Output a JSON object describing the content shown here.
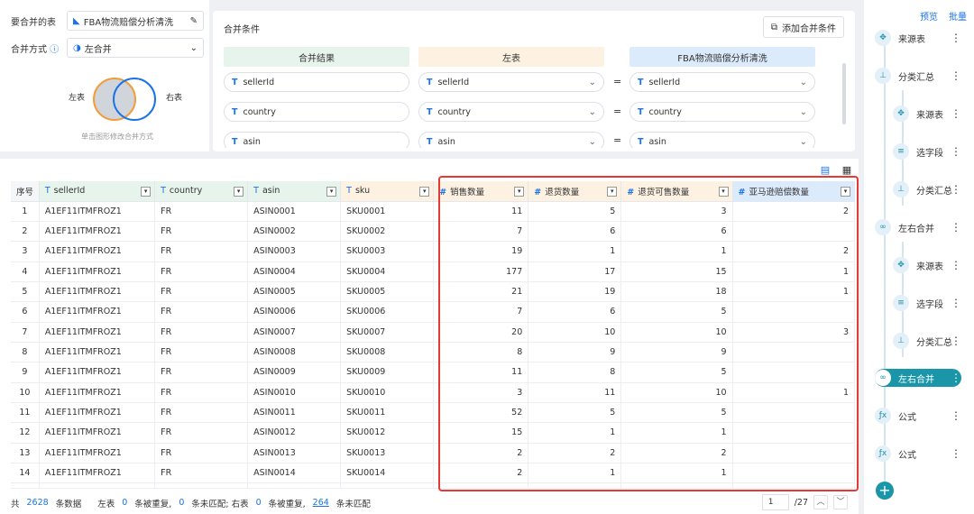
{
  "config": {
    "table_label": "要合并的表",
    "table_name": "FBA物流赔偿分析清洗",
    "method_label": "合并方式",
    "method_value": "左合并",
    "left_label": "左表",
    "right_label": "右表",
    "hint": "单击图形修改合并方式"
  },
  "conditions": {
    "title": "合并条件",
    "add_button": "添加合并条件",
    "headers": {
      "result": "合并结果",
      "left": "左表",
      "right": "FBA物流赔偿分析清洗"
    },
    "rows": [
      {
        "result": "sellerId",
        "left": "sellerId",
        "right": "sellerId"
      },
      {
        "result": "country",
        "left": "country",
        "right": "country"
      },
      {
        "result": "asin",
        "left": "asin",
        "right": "asin"
      }
    ]
  },
  "grid": {
    "columns": [
      {
        "label": "序号",
        "type": "",
        "color": "plain"
      },
      {
        "label": "sellerId",
        "type": "T",
        "color": "g"
      },
      {
        "label": "country",
        "type": "T",
        "color": "g"
      },
      {
        "label": "asin",
        "type": "T",
        "color": "g"
      },
      {
        "label": "sku",
        "type": "T",
        "color": "o"
      },
      {
        "label": "销售数量",
        "type": "#",
        "color": "o"
      },
      {
        "label": "退货数量",
        "type": "#",
        "color": "o"
      },
      {
        "label": "退货可售数量",
        "type": "#",
        "color": "o"
      },
      {
        "label": "亚马逊赔偿数量",
        "type": "#",
        "color": "b"
      }
    ],
    "rows": [
      [
        "1",
        "A1EF11ITMFROZ1",
        "FR",
        "ASIN0001",
        "SKU0001",
        "11",
        "5",
        "3",
        "2"
      ],
      [
        "2",
        "A1EF11ITMFROZ1",
        "FR",
        "ASIN0002",
        "SKU0002",
        "7",
        "6",
        "6",
        ""
      ],
      [
        "3",
        "A1EF11ITMFROZ1",
        "FR",
        "ASIN0003",
        "SKU0003",
        "19",
        "1",
        "1",
        "2"
      ],
      [
        "4",
        "A1EF11ITMFROZ1",
        "FR",
        "ASIN0004",
        "SKU0004",
        "177",
        "17",
        "15",
        "1"
      ],
      [
        "5",
        "A1EF11ITMFROZ1",
        "FR",
        "ASIN0005",
        "SKU0005",
        "21",
        "19",
        "18",
        "1"
      ],
      [
        "6",
        "A1EF11ITMFROZ1",
        "FR",
        "ASIN0006",
        "SKU0006",
        "7",
        "6",
        "5",
        ""
      ],
      [
        "7",
        "A1EF11ITMFROZ1",
        "FR",
        "ASIN0007",
        "SKU0007",
        "20",
        "10",
        "10",
        "3"
      ],
      [
        "8",
        "A1EF11ITMFROZ1",
        "FR",
        "ASIN0008",
        "SKU0008",
        "8",
        "9",
        "9",
        ""
      ],
      [
        "9",
        "A1EF11ITMFROZ1",
        "FR",
        "ASIN0009",
        "SKU0009",
        "11",
        "8",
        "5",
        ""
      ],
      [
        "10",
        "A1EF11ITMFROZ1",
        "FR",
        "ASIN0010",
        "SKU0010",
        "3",
        "11",
        "10",
        "1"
      ],
      [
        "11",
        "A1EF11ITMFROZ1",
        "FR",
        "ASIN0011",
        "SKU0011",
        "52",
        "5",
        "5",
        ""
      ],
      [
        "12",
        "A1EF11ITMFROZ1",
        "FR",
        "ASIN0012",
        "SKU0012",
        "15",
        "1",
        "1",
        ""
      ],
      [
        "13",
        "A1EF11ITMFROZ1",
        "FR",
        "ASIN0013",
        "SKU0013",
        "2",
        "2",
        "2",
        ""
      ],
      [
        "14",
        "A1EF11ITMFROZ1",
        "FR",
        "ASIN0014",
        "SKU0014",
        "2",
        "1",
        "1",
        ""
      ]
    ]
  },
  "footer": {
    "total_prefix": "共",
    "total": "2628",
    "total_suffix": "条数据",
    "left_prefix": "左表",
    "left_dup": "0",
    "dup_text": "条被重复,",
    "left_unmatched": "0",
    "unmatched_text": "条未匹配; 右表",
    "right_dup": "0",
    "dup_text2": "条被重复,",
    "right_unmatched": "264",
    "unmatched_text2": "条未匹配",
    "page": "1",
    "pages": "/27"
  },
  "flow": {
    "preview": "预览",
    "batch": "批量",
    "nodes": [
      {
        "label": "来源表",
        "icon": "source-icon"
      },
      {
        "label": "分类汇总",
        "icon": "group-icon"
      },
      {
        "label": "来源表",
        "icon": "source-icon"
      },
      {
        "label": "选字段",
        "icon": "fields-icon"
      },
      {
        "label": "分类汇总",
        "icon": "group-icon"
      },
      {
        "label": "左右合并",
        "icon": "merge-icon"
      },
      {
        "label": "来源表",
        "icon": "source-icon"
      },
      {
        "label": "选字段",
        "icon": "fields-icon"
      },
      {
        "label": "分类汇总",
        "icon": "group-icon"
      },
      {
        "label": "左右合并",
        "icon": "merge-icon"
      },
      {
        "label": "公式",
        "icon": "formula-icon"
      },
      {
        "label": "公式",
        "icon": "formula-icon"
      }
    ]
  },
  "colors": {
    "accent": "#1a73e8",
    "teal": "#1a96a8",
    "highlight": "#e53935"
  }
}
